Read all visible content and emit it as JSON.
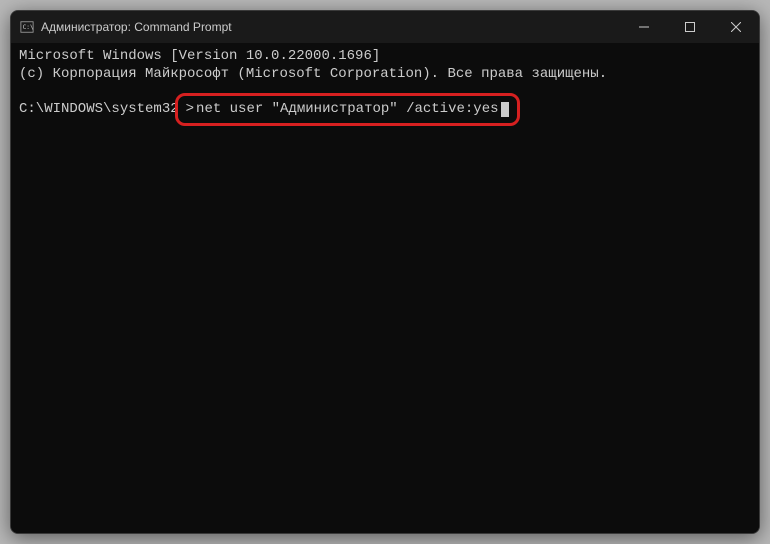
{
  "window": {
    "title": "Администратор: Command Prompt"
  },
  "terminal": {
    "line1": "Microsoft Windows [Version 10.0.22000.1696]",
    "line2": "(c) Корпорация Майкрософт (Microsoft Corporation). Все права защищены.",
    "blank": "",
    "promptPrefix": "C:\\WINDOWS\\system32",
    "promptChar": ">",
    "command": "net user \"Администратор\" /active:yes"
  }
}
